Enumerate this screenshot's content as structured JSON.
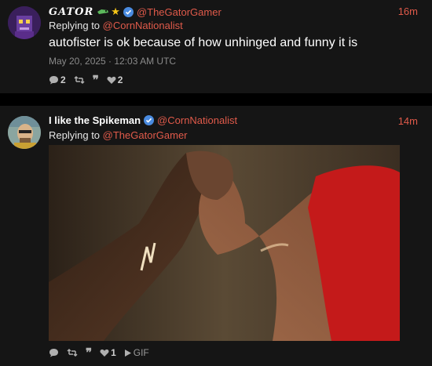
{
  "post1": {
    "display_name": "GATOR",
    "handle": "@TheGatorGamer",
    "time": "16m",
    "replying_label": "Replying to",
    "replying_handle": "@CornNationalist",
    "text": "autofister is ok because of how unhinged and funny it is",
    "timestamp": "May 20, 2025 · 12:03 AM UTC",
    "reply_count": "2",
    "like_count": "2"
  },
  "post2": {
    "display_name": "I like the Spikeman",
    "handle": "@CornNationalist",
    "time": "14m",
    "replying_label": "Replying to",
    "replying_handle": "@TheGatorGamer",
    "like_count": "1",
    "media_label": "GIF"
  },
  "colors": {
    "accent": "#e05a4a",
    "verified": "#4a8be0",
    "background": "#000000",
    "card": "#151515"
  }
}
